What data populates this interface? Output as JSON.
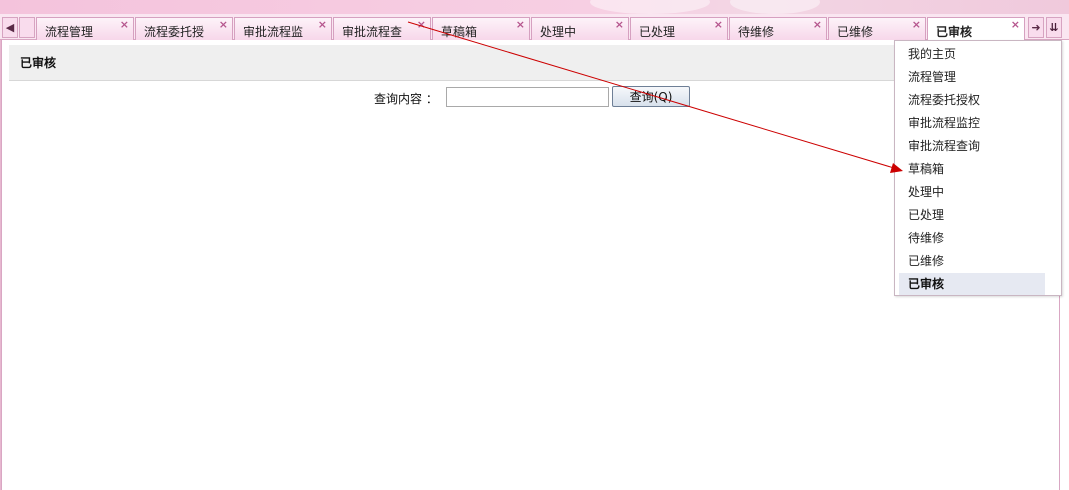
{
  "tabbar": {
    "scroll_left_glyph": "◆",
    "scroll_right_glyph": "➜",
    "menu_glyph": "¥",
    "close_glyph": "×",
    "tabs": [
      {
        "label": "流程管理"
      },
      {
        "label": "流程委托授"
      },
      {
        "label": "审批流程监"
      },
      {
        "label": "审批流程查"
      },
      {
        "label": "草稿箱"
      },
      {
        "label": "处理中"
      },
      {
        "label": "已处理"
      },
      {
        "label": "待维修"
      },
      {
        "label": "已维修"
      },
      {
        "label": "已审核",
        "active": true
      }
    ]
  },
  "panel": {
    "title": "已审核"
  },
  "search": {
    "label": "查询内容 ：",
    "value": "",
    "button_label": "查询(Q)"
  },
  "dropdown": {
    "items": [
      {
        "label": "我的主页"
      },
      {
        "label": "流程管理"
      },
      {
        "label": "流程委托授权"
      },
      {
        "label": "审批流程监控"
      },
      {
        "label": "审批流程查询"
      },
      {
        "label": "草稿箱"
      },
      {
        "label": "处理中"
      },
      {
        "label": "已处理"
      },
      {
        "label": "待维修"
      },
      {
        "label": "已维修"
      },
      {
        "label": "已审核",
        "selected": true
      }
    ]
  },
  "colors": {
    "annotation_arrow": "#cc0000",
    "tab_close": "#b5558d",
    "banner": "#f4c3dc"
  }
}
